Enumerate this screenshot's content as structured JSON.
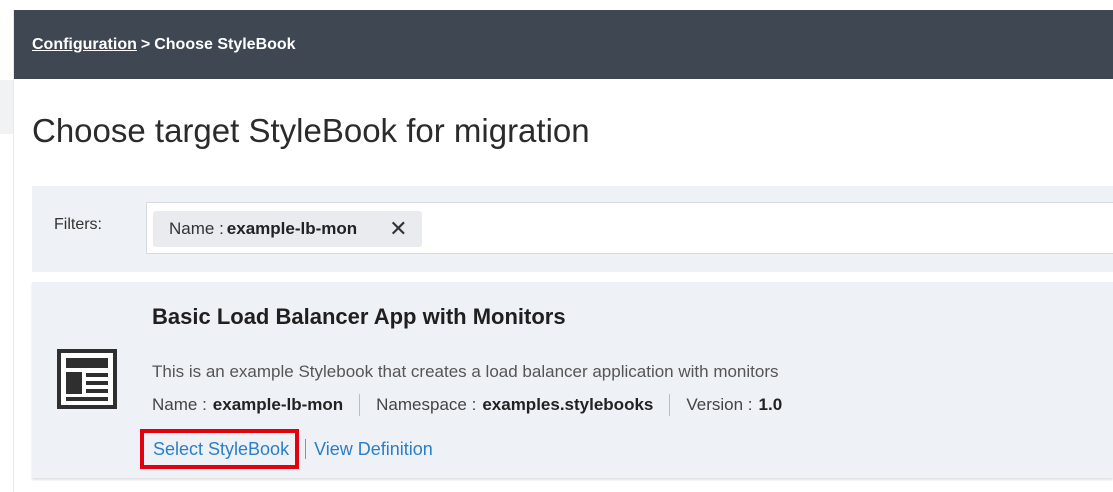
{
  "breadcrumb": {
    "link_label": "Configuration",
    "separator": ">",
    "current": "Choose StyleBook"
  },
  "page": {
    "title": "Choose target StyleBook for migration"
  },
  "filters": {
    "label": "Filters:",
    "chip": {
      "key": "Name :",
      "value": "example-lb-mon",
      "close_icon": "✕"
    }
  },
  "stylebook": {
    "icon": "stylebook-layout-icon",
    "title": "Basic Load Balancer App with Monitors",
    "description": "This is an example Stylebook that creates a load balancer application with monitors",
    "name_label": "Name :",
    "name_value": "example-lb-mon",
    "namespace_label": "Namespace :",
    "namespace_value": "examples.stylebooks",
    "version_label": "Version :",
    "version_value": "1.0",
    "select_label": "Select StyleBook",
    "view_label": "View Definition"
  },
  "colors": {
    "header_bg": "#3e4752",
    "panel_bg": "#eef1f5",
    "link": "#2a7fc8",
    "highlight": "#e3000f"
  }
}
